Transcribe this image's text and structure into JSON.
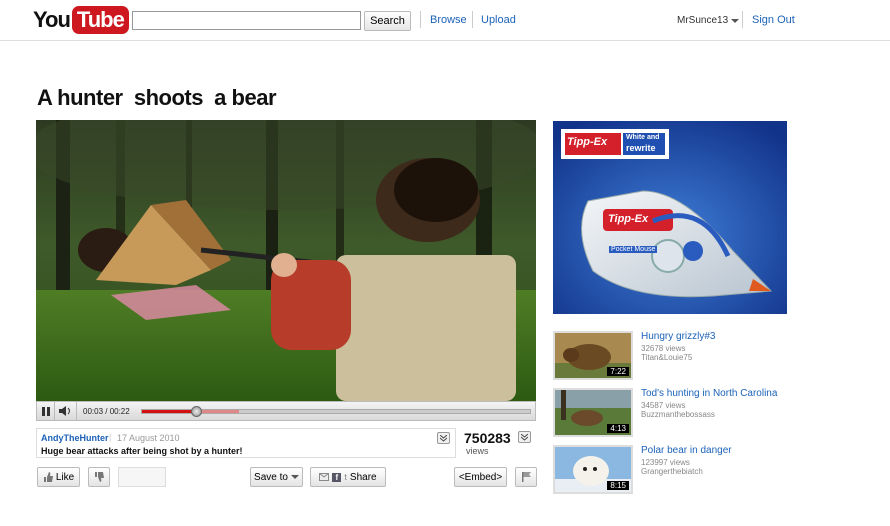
{
  "header": {
    "logo_you": "You",
    "logo_tube": "Tube",
    "search_placeholder": "",
    "search_button": "Search",
    "browse": "Browse",
    "upload": "Upload",
    "username": "MrSunce13",
    "sign_out": "Sign Out"
  },
  "video": {
    "title": "A hunter  shoots  a bear",
    "time": "00:03 / 00:22",
    "progress_played": 0.14,
    "progress_buffered": 0.25,
    "uploader": "AndyTheHunter",
    "date": "17 August 2010",
    "description": "Huge bear attacks after being shot by a hunter!",
    "views_count": "750283",
    "views_label": "views"
  },
  "actions": {
    "like": "Like",
    "save_to": "Save to",
    "share": "Share",
    "embed": "<Embed>"
  },
  "ad": {
    "brand": "Tipp-Ex",
    "tagline_line1": "White and",
    "tagline_line2": "rewrite",
    "product_brand": "Tipp-Ex",
    "product_name": "Pocket Mouse"
  },
  "related": [
    {
      "title": "Hungry grizzly#3",
      "views": "32678 views",
      "author": "Titan&Louie75",
      "duration": "7:22"
    },
    {
      "title": "Tod's hunting in North Carolina",
      "views": "34587 views",
      "author": "Buzzmanthebossass",
      "duration": "4:13"
    },
    {
      "title": "Polar bear in danger",
      "views": "123997 views",
      "author": "Grangerthebiatch",
      "duration": "8:15"
    }
  ],
  "colors": {
    "link": "#1c62b9",
    "brand_red": "#cc181e",
    "progress": "#d41010"
  }
}
